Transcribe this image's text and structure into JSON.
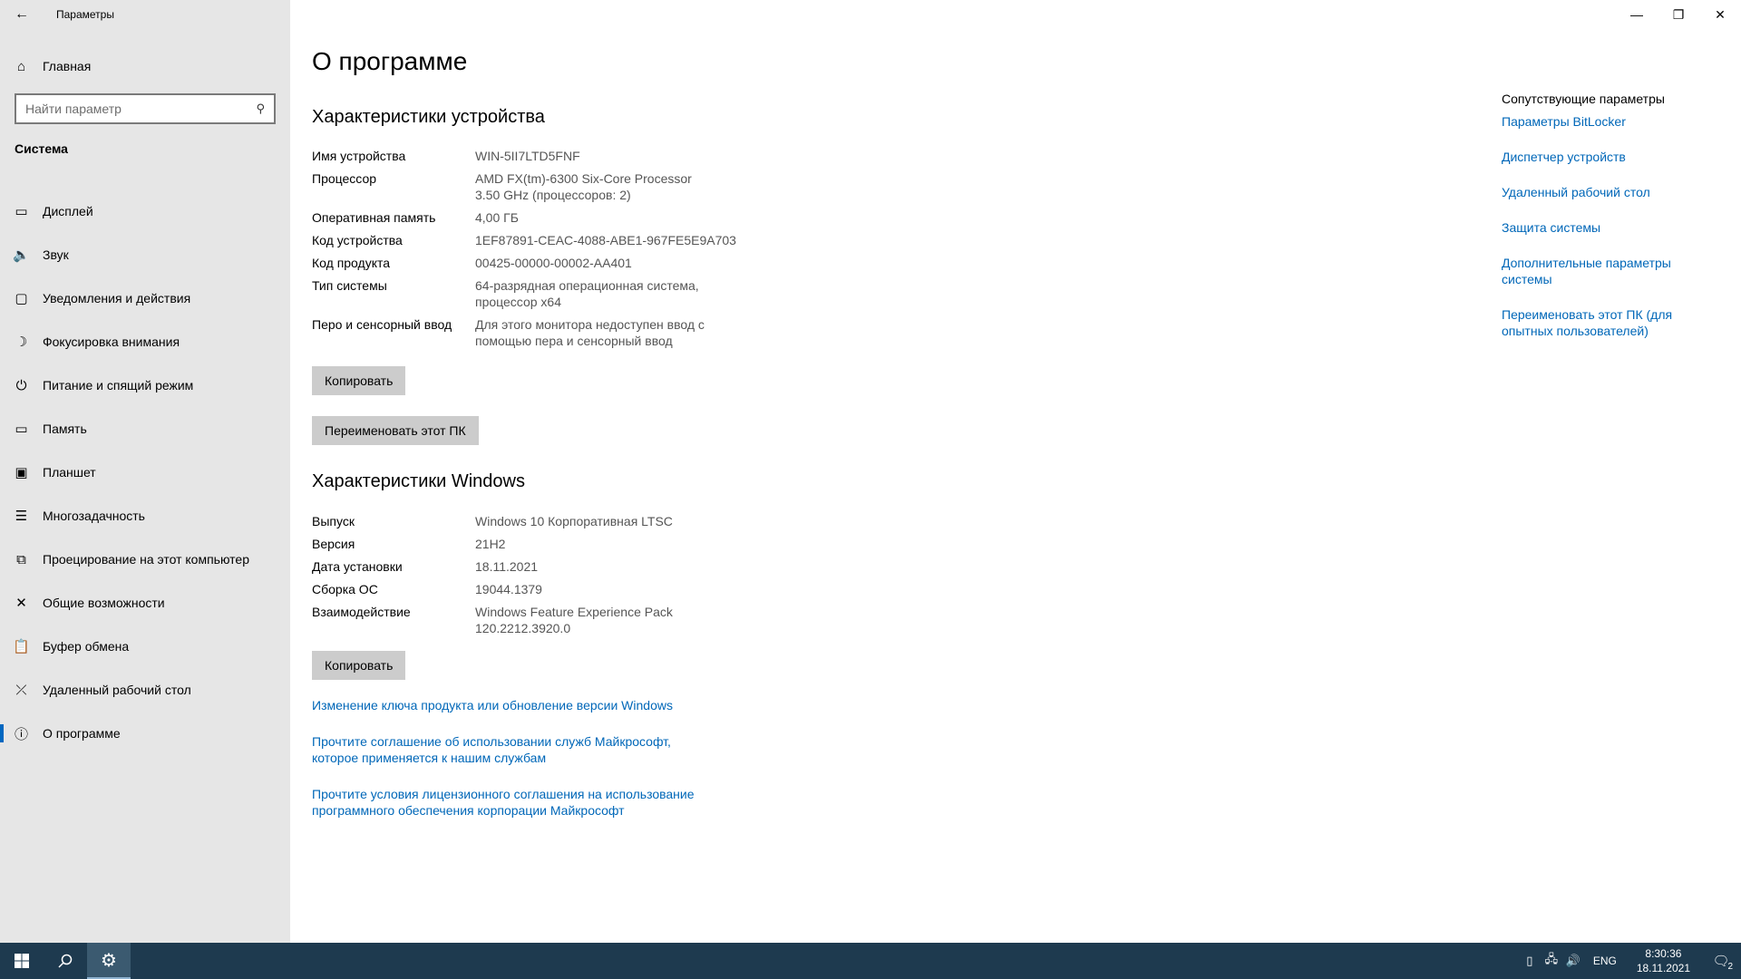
{
  "window": {
    "title": "Параметры",
    "back_icon": "arrow-left-icon",
    "minimize_symbol": "—",
    "maximize_symbol": "❐",
    "close_symbol": "✕"
  },
  "sidebar": {
    "home_label": "Главная",
    "home_icon": "home-icon",
    "search_placeholder": "Найти параметр",
    "section_label": "Система",
    "items": [
      {
        "label": "Дисплей",
        "icon": "display-icon",
        "glyph": "▭"
      },
      {
        "label": "Звук",
        "icon": "speaker-icon",
        "glyph": "🔈"
      },
      {
        "label": "Уведомления и действия",
        "icon": "notification-icon",
        "glyph": "▢"
      },
      {
        "label": "Фокусировка внимания",
        "icon": "moon-icon",
        "glyph": "☽"
      },
      {
        "label": "Питание и спящий режим",
        "icon": "power-icon",
        "glyph": "⏻"
      },
      {
        "label": "Память",
        "icon": "storage-icon",
        "glyph": "▭"
      },
      {
        "label": "Планшет",
        "icon": "tablet-icon",
        "glyph": "▣"
      },
      {
        "label": "Многозадачность",
        "icon": "multitasking-icon",
        "glyph": "☰"
      },
      {
        "label": "Проецирование на этот компьютер",
        "icon": "project-icon",
        "glyph": "⧉"
      },
      {
        "label": "Общие возможности",
        "icon": "shared-experiences-icon",
        "glyph": "✕"
      },
      {
        "label": "Буфер обмена",
        "icon": "clipboard-icon",
        "glyph": "📋"
      },
      {
        "label": "Удаленный рабочий стол",
        "icon": "remote-desktop-icon",
        "glyph": "⤫"
      },
      {
        "label": "О программе",
        "icon": "info-icon",
        "glyph": "ⓘ",
        "active": true
      }
    ]
  },
  "main": {
    "page_title": "О программе",
    "device_specs_title": "Характеристики устройства",
    "device_specs": [
      {
        "label": "Имя устройства",
        "value": "WIN-5II7LTD5FNF"
      },
      {
        "label": "Процессор",
        "value": "AMD FX(tm)-6300 Six-Core Processor\n3.50 GHz (процессоров: 2)"
      },
      {
        "label": "Оперативная память",
        "value": "4,00 ГБ"
      },
      {
        "label": "Код устройства",
        "value": "1EF87891-CEAC-4088-ABE1-967FE5E9A703"
      },
      {
        "label": "Код продукта",
        "value": "00425-00000-00002-AA401"
      },
      {
        "label": "Тип системы",
        "value": "64-разрядная операционная система,\nпроцессор x64"
      },
      {
        "label": "Перо и сенсорный ввод",
        "value": "Для этого монитора недоступен ввод с\nпомощью пера и сенсорный ввод"
      }
    ],
    "copy_button": "Копировать",
    "rename_button": "Переименовать этот ПК",
    "windows_specs_title": "Характеристики Windows",
    "windows_specs": [
      {
        "label": "Выпуск",
        "value": "Windows 10 Корпоративная LTSC"
      },
      {
        "label": "Версия",
        "value": "21H2"
      },
      {
        "label": "Дата установки",
        "value": "18.11.2021"
      },
      {
        "label": "Сборка ОС",
        "value": "19044.1379"
      },
      {
        "label": "Взаимодействие",
        "value": "Windows Feature Experience Pack\n120.2212.3920.0"
      }
    ],
    "copy_button_2": "Копировать",
    "links": [
      "Изменение ключа продукта или обновление версии Windows",
      "Прочтите соглашение об использовании служб Майкрософт,\nкоторое применяется к нашим службам",
      "Прочтите условия лицензионного соглашения на использование\nпрограммного обеспечения корпорации Майкрософт"
    ]
  },
  "related": {
    "title": "Сопутствующие параметры",
    "links": [
      "Параметры BitLocker",
      "Диспетчер устройств",
      "Удаленный рабочий стол",
      "Защита системы",
      "Дополнительные параметры\nсистемы",
      "Переименовать этот ПК (для\nопытных пользователей)"
    ]
  },
  "taskbar": {
    "lang": "ENG",
    "time": "8:30:36",
    "date": "18.11.2021",
    "notification_count": "2",
    "colors": {
      "background": "#1e3a4f",
      "active": "#3b5a70"
    }
  }
}
